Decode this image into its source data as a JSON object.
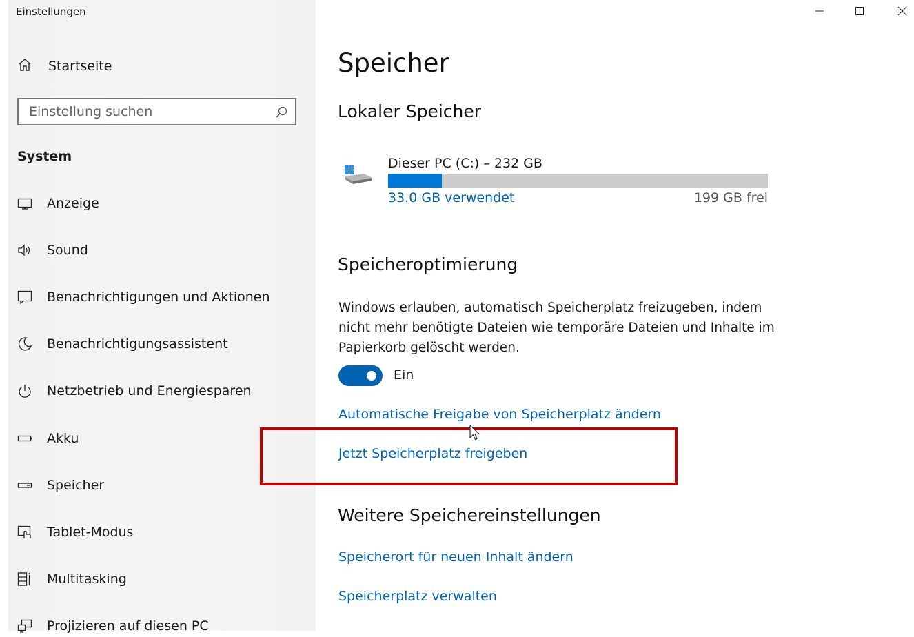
{
  "window": {
    "title": "Einstellungen"
  },
  "sidebar": {
    "home_label": "Startseite",
    "search_placeholder": "Einstellung suchen",
    "section_label": "System",
    "items": [
      {
        "label": "Anzeige",
        "icon": "display-icon"
      },
      {
        "label": "Sound",
        "icon": "sound-icon"
      },
      {
        "label": "Benachrichtigungen und Aktionen",
        "icon": "notification-icon"
      },
      {
        "label": "Benachrichtigungsassistent",
        "icon": "moon-icon"
      },
      {
        "label": "Netzbetrieb und Energiesparen",
        "icon": "power-icon"
      },
      {
        "label": "Akku",
        "icon": "battery-icon"
      },
      {
        "label": "Speicher",
        "icon": "storage-icon"
      },
      {
        "label": "Tablet-Modus",
        "icon": "tablet-mode-icon"
      },
      {
        "label": "Multitasking",
        "icon": "multitasking-icon"
      },
      {
        "label": "Projizieren auf diesen PC",
        "icon": "project-icon"
      }
    ]
  },
  "main": {
    "title": "Speicher",
    "local_storage": {
      "heading": "Lokaler Speicher",
      "drive_name": "Dieser PC (C:) – 232 GB",
      "used_label": "33.0 GB verwendet",
      "free_label": "199 GB frei",
      "used_fraction": 0.142
    },
    "optimization": {
      "heading": "Speicheroptimierung",
      "description": "Windows erlauben, automatisch Speicherplatz freizugeben, indem nicht mehr benötigte Dateien wie temporäre Dateien und Inhalte im Papierkorb gelöscht werden.",
      "toggle_state": "Ein",
      "link_change": "Automatische Freigabe von Speicherplatz ändern",
      "link_free_now": "Jetzt Speicherplatz freigeben"
    },
    "more": {
      "heading": "Weitere Speichereinstellungen",
      "link_location": "Speicherort für neuen Inhalt ändern",
      "link_manage": "Speicherplatz verwalten"
    }
  },
  "colors": {
    "accent": "#0078d7",
    "link": "#0063b1",
    "highlight": "#c00000",
    "bar_track": "#cccccc"
  }
}
